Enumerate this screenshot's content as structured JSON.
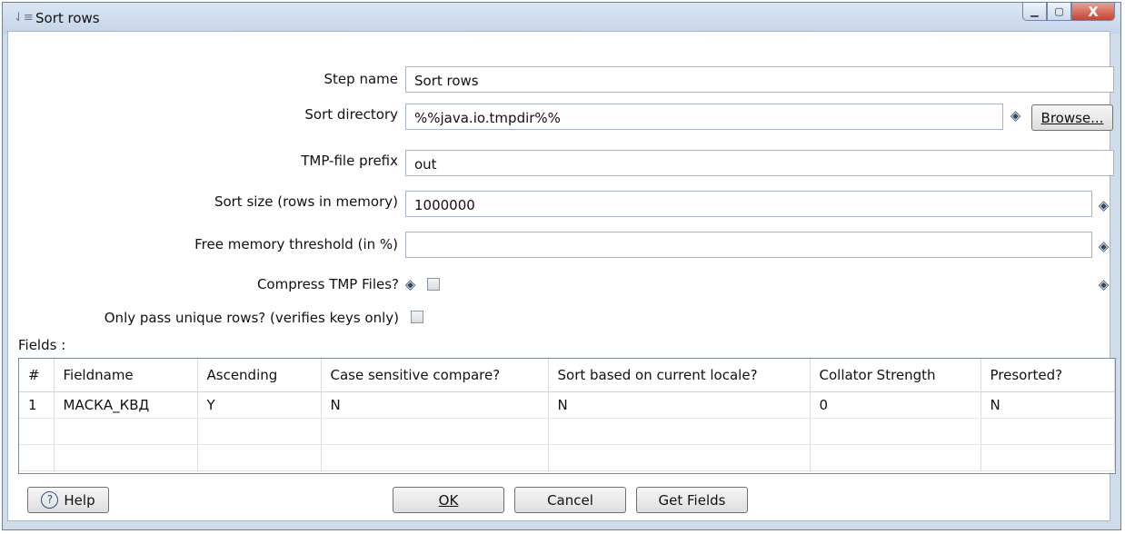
{
  "window": {
    "title": "Sort rows",
    "title_icon": "sort-icon",
    "controls": {
      "minimize": "▁",
      "maximize": "▢",
      "close": "X"
    }
  },
  "form": {
    "step_name_label": "Step name",
    "step_name_value": "Sort rows",
    "sort_directory_label": "Sort directory",
    "sort_directory_value": "%%java.io.tmpdir%%",
    "browse_label": "Browse...",
    "tmp_prefix_label": "TMP-file prefix",
    "tmp_prefix_value": "out",
    "sort_size_label": "Sort size (rows in memory)",
    "sort_size_value": "1000000",
    "free_memory_label": "Free memory threshold (in %)",
    "free_memory_value": "",
    "compress_label": "Compress TMP Files?",
    "compress_checked": false,
    "unique_label": "Only pass unique rows? (verifies keys only)",
    "unique_checked": false,
    "fields_label": "Fields :"
  },
  "table": {
    "columns": [
      "#",
      "Fieldname",
      "Ascending",
      "Case sensitive compare?",
      "Sort based on current locale?",
      "Collator Strength",
      "Presorted?"
    ],
    "rows": [
      [
        "1",
        "МАСКА_КВД",
        "Y",
        "N",
        "N",
        "0",
        "N"
      ],
      [
        "",
        "",
        "",
        "",
        "",
        "",
        ""
      ],
      [
        "",
        "",
        "",
        "",
        "",
        "",
        ""
      ]
    ]
  },
  "buttons": {
    "help": "Help",
    "ok": "OK",
    "cancel": "Cancel",
    "get_fields": "Get Fields"
  },
  "icons": {
    "variable": "dollar-diamond-icon",
    "help": "question-circle-icon"
  }
}
